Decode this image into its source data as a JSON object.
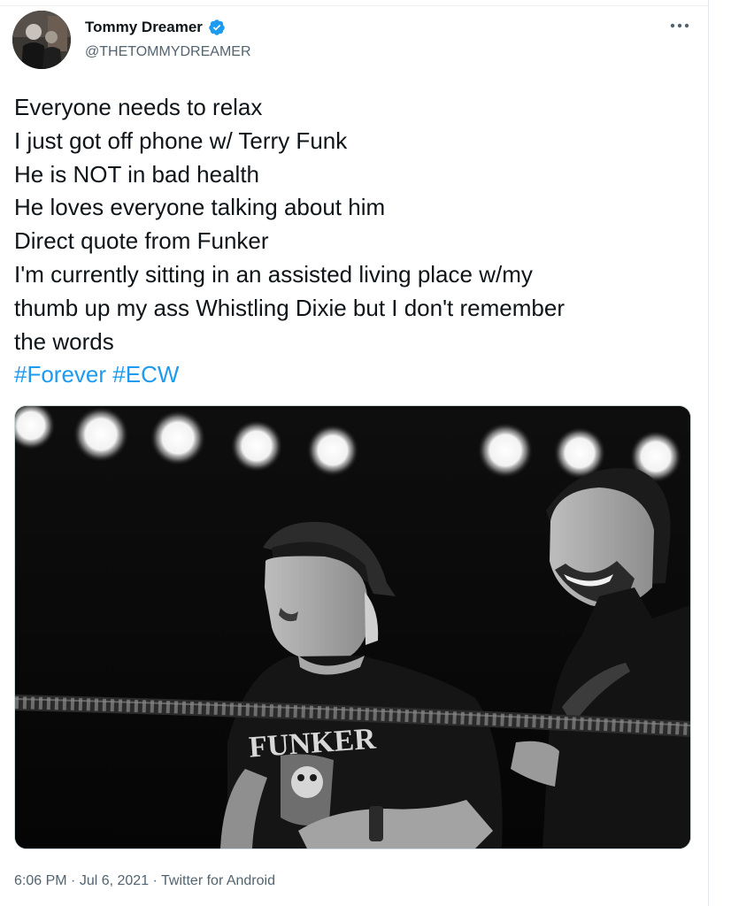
{
  "author": {
    "display_name": "Tommy Dreamer",
    "handle": "@THETOMMYDREAMER",
    "verified": true,
    "verified_icon": "verified-badge-icon",
    "avatar_icon": "avatar"
  },
  "more_icon": "more-dots-icon",
  "more_glyph": "•••",
  "tweet": {
    "lines": [
      "Everyone needs to relax",
      "I just got off phone w/ Terry Funk",
      "He is NOT in bad health",
      "He loves everyone talking about him",
      "Direct quote from Funker",
      "I'm currently sitting in an assisted living place w/my",
      "thumb up my ass Whistling Dixie but I don't remember",
      "the words"
    ],
    "hashtags": [
      "#Forever",
      "#ECW"
    ]
  },
  "photo": {
    "shirt_text": "FUNKER"
  },
  "meta": {
    "time": "6:06 PM",
    "separator": " · ",
    "date": "Jul 6, 2021",
    "source": "Twitter for Android"
  },
  "colors": {
    "link": "#1d9bf0",
    "verified": "#1d9bf0",
    "text": "#0f1419",
    "muted": "#536471"
  }
}
